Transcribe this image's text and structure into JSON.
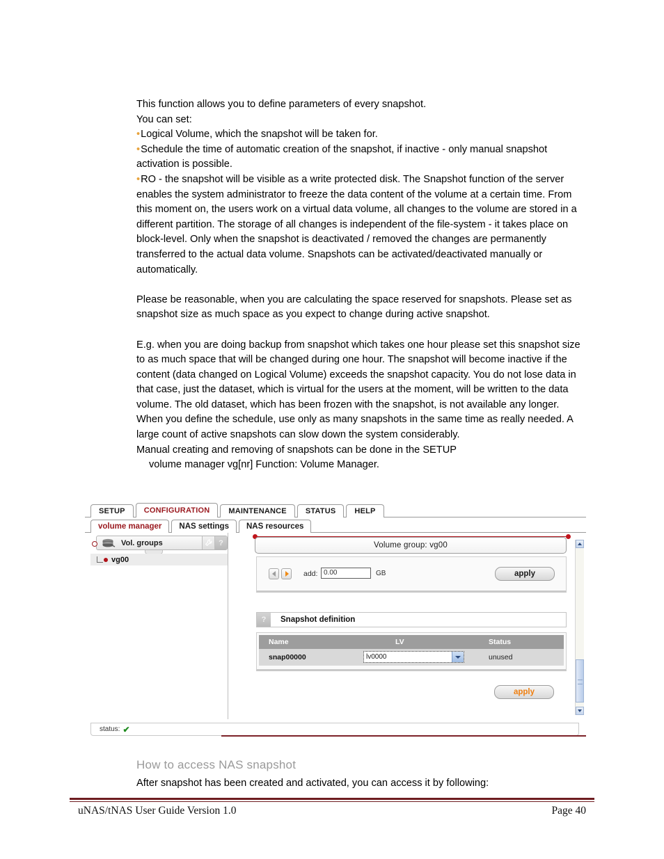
{
  "document": {
    "intro": [
      "This function allows you to define parameters of every snapshot.",
      "You can set:"
    ],
    "bullets": [
      "Logical Volume, which the snapshot will be taken for.",
      "Schedule the time of automatic creation of the snapshot, if inactive - only manual snapshot activation is possible.",
      "RO - the snapshot will be visible as a write protected disk. The Snapshot function of the server enables the system administrator to freeze the data content of the volume at a certain time. From this moment on, the users work on a virtual data volume, all changes to the volume are stored in a different partition. The storage of all changes is independent of the file-system - it takes place on block-level. Only when the snapshot is deactivated / removed the changes are permanently transferred to the actual data volume. Snapshots can be activated/deactivated manually or automatically."
    ],
    "paragraph_reasonable": "Please be reasonable, when you are calculating the space reserved for snapshots. Please set as snapshot size as much space as you expect to change during active snapshot.",
    "paragraph_eg": "E.g. when you are doing backup from snapshot which takes one hour please set this snapshot size to as much space that will be changed during one hour. The snapshot will become inactive if the content (data changed on Logical Volume) exceeds the snapshot capacity. You do not lose data in that case, just the dataset, which is virtual for the users at the moment, will be written to the data volume. The old dataset, which has been frozen with the snapshot, is not available any longer. When you define the schedule, use only as many snapshots in the same time as really needed. A large count of active snapshots can slow down the system considerably.",
    "paragraph_manual": "Manual creating and removing of snapshots can be done in the SETUP",
    "paragraph_path": "volume manager     vg[nr]     Function: Volume Manager.",
    "section_heading": "How to access NAS snapshot",
    "after_snapshot_text": "After snapshot has been created and activated, you can access it by following:"
  },
  "screenshot": {
    "primary_tabs": [
      {
        "label": "SETUP",
        "active": false
      },
      {
        "label": "CONFIGURATION",
        "active": true
      },
      {
        "label": "MAINTENANCE",
        "active": false
      },
      {
        "label": "STATUS",
        "active": false
      },
      {
        "label": "HELP",
        "active": false
      }
    ],
    "secondary_tabs": [
      {
        "label": "volume manager",
        "active": true
      },
      {
        "label": "NAS settings",
        "active": false
      },
      {
        "label": "NAS resources",
        "active": false
      }
    ],
    "tree": {
      "header_label": "Vol. groups",
      "help_glyph": "?",
      "node_label": "vg00"
    },
    "volume_group": {
      "header_title": "Volume group: vg00",
      "add_label": "add:",
      "add_value": "0.00",
      "unit_label": "GB",
      "apply_label": "apply"
    },
    "snapshot": {
      "section_help_glyph": "?",
      "section_title": "Snapshot definition",
      "columns": [
        "Name",
        "LV",
        "Status"
      ],
      "rows": [
        {
          "name": "snap00000",
          "lv": "lv0000",
          "status": "unused"
        }
      ],
      "apply_label": "apply"
    },
    "statusbar": {
      "label": "status:",
      "check_glyph": "✔"
    }
  },
  "footer": {
    "left": "uNAS/tNAS User Guide Version 1.0",
    "right": "Page 40"
  },
  "colors": {
    "accent_red": "#9b1b21",
    "marker_red": "#c0151c",
    "bullet_gold": "#e8a33d",
    "apply_orange": "#ef7f10",
    "footer_rule": "#6e1d21",
    "heading_gray": "#9a9a9a"
  }
}
